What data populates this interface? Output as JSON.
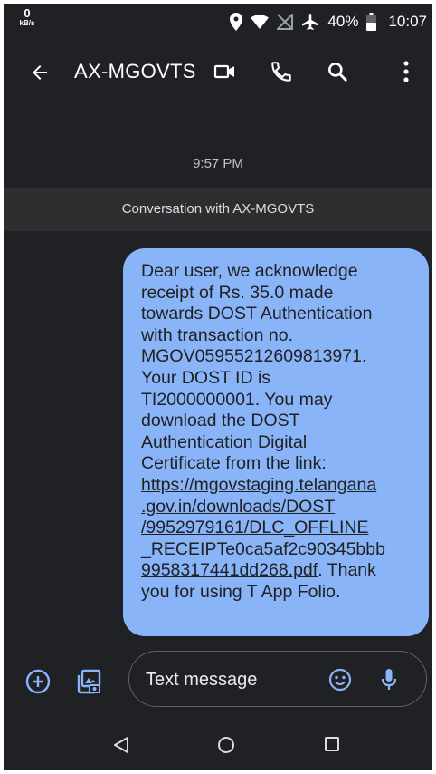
{
  "status_bar": {
    "net_speed_value": "0",
    "net_speed_unit": "kB/s",
    "battery_percent": "40%",
    "time": "10:07",
    "icons": [
      "location-icon",
      "wifi-icon",
      "no-sim-icon",
      "airplane-mode-icon",
      "battery-icon"
    ]
  },
  "app_bar": {
    "title": "AX-MGOVTS",
    "icons": [
      "back-arrow-icon",
      "video-call-icon",
      "phone-call-icon",
      "search-icon",
      "more-vert-icon"
    ]
  },
  "conversation": {
    "timestamp": "9:57 PM",
    "banner": "Conversation with AX-MGOVTS",
    "message": {
      "text_lines": [
        "Dear user, we acknowledge",
        "receipt of Rs. 35.0 made",
        "towards DOST Authentication",
        "with transaction no.",
        "MGOV05955212609813971.",
        "Your DOST ID is",
        "TI2000000001. You may",
        "download the DOST",
        "Authentication Digital",
        "Certificate from the link:"
      ],
      "link_lines": [
        "https://mgovstaging.telangana",
        ".gov.in/downloads/DOST",
        "/9952979161/DLC_OFFLINE",
        "_RECEIPTe0ca5af2c90345bbb"
      ],
      "link_last_line": "9958317441dd268.pdf",
      "tail_on_link_line": ". Thank",
      "tail_line": "you for using T App Folio."
    }
  },
  "composer": {
    "placeholder": "Text message",
    "icons": [
      "add-icon",
      "gallery-icon",
      "emoji-icon",
      "mic-icon"
    ]
  },
  "nav_bar": {
    "icons": [
      "nav-back-icon",
      "nav-home-icon",
      "nav-recents-icon"
    ]
  },
  "colors": {
    "background": "#202124",
    "bubble": "#8ab4f8",
    "accent": "#8ab4f8",
    "banner": "#2d2e30"
  }
}
